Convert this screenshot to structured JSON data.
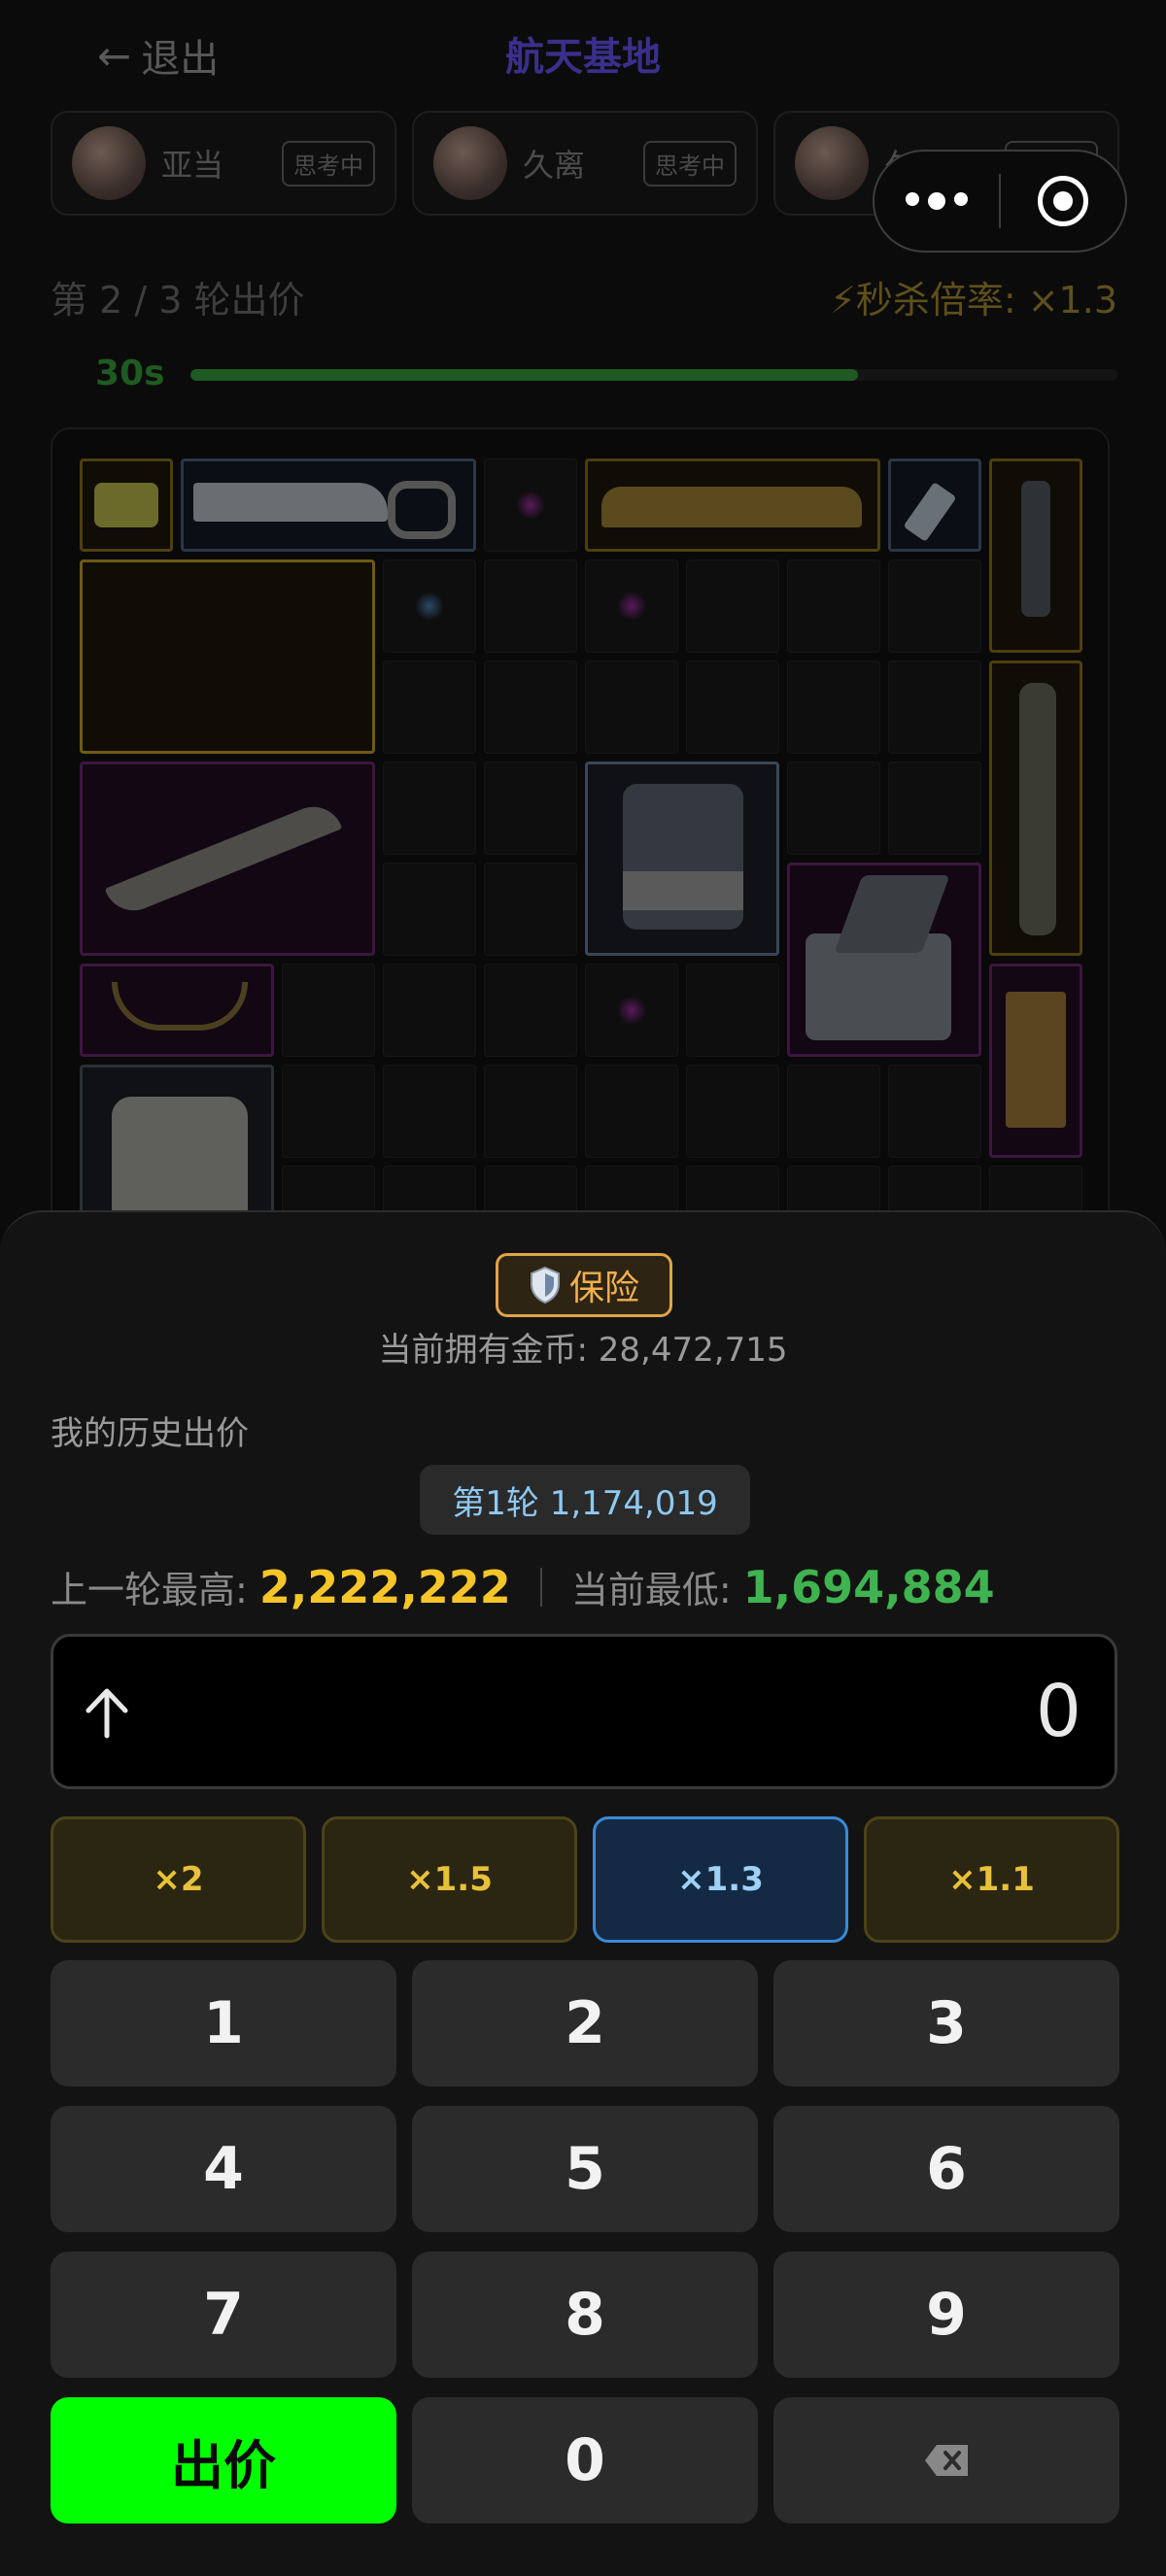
{
  "header": {
    "back_label": "退出",
    "title": "航天基地"
  },
  "players": [
    {
      "name": "亚当",
      "status": "思考中"
    },
    {
      "name": "久离",
      "status": "思考中"
    },
    {
      "name": "久离",
      "status": "思考中"
    }
  ],
  "round_info": {
    "round_label": "第 2 / 3 轮出价",
    "seckill_label": "⚡秒杀倍率: ×1.3"
  },
  "timer": {
    "label": "30s",
    "progress": 0.72
  },
  "sheet": {
    "insurance_label": "保险",
    "coins_text": "当前拥有金币: 28,472,715",
    "history_label": "我的历史出价",
    "history": [
      {
        "text": "第1轮 1,174,019"
      }
    ],
    "last_high_label": "上一轮最高:",
    "last_high_value": "2,222,222",
    "current_low_label": "当前最低:",
    "current_low_value": "1,694,884",
    "input_value": "0",
    "multipliers": [
      {
        "label": "×2",
        "active": false
      },
      {
        "label": "×1.5",
        "active": false
      },
      {
        "label": "×1.3",
        "active": true
      },
      {
        "label": "×1.1",
        "active": false
      }
    ],
    "keypad": [
      "1",
      "2",
      "3",
      "4",
      "5",
      "6",
      "7",
      "8",
      "9",
      "出价",
      "0",
      "⌫"
    ],
    "bid_label": "出价"
  },
  "colors": {
    "accent_green": "#00ff00",
    "gold": "#f5c62a",
    "low_green": "#3fb34f",
    "active_blue": "#3a8ad6"
  }
}
